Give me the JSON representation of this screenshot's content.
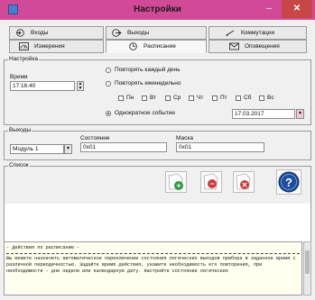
{
  "window": {
    "title": "Настройки",
    "min_symbol": "–",
    "close_symbol": "✕"
  },
  "tabs_row1": [
    {
      "label": "Входы"
    },
    {
      "label": "Выходы"
    },
    {
      "label": "Коммутации"
    }
  ],
  "tabs_row2": [
    {
      "label": "Измерения"
    },
    {
      "label": "Расписание"
    },
    {
      "label": "Оповещения"
    }
  ],
  "settings_group": {
    "label": "Настройка",
    "time_label": "Время",
    "time_value": "17:16:40",
    "repeat_daily": "Повторять каждый день",
    "repeat_weekly": "Повторять еженедельно",
    "days": [
      "Пн",
      "Вт",
      "Ср",
      "Чт",
      "Пт",
      "Сб",
      "Вс"
    ],
    "one_time": "Однократное событие",
    "date_value": "17.03.2017"
  },
  "outputs_group": {
    "label": "Выходы",
    "module_value": "Модуль 1",
    "state_label": "Состояние",
    "state_value": "0x01",
    "mask_label": "Маска",
    "mask_value": "0x01"
  },
  "list_group": {
    "label": "Список"
  },
  "toolbar": {
    "add_symbol": "+",
    "remove_symbol": "−",
    "delete_symbol": "✕",
    "help_symbol": "?"
  },
  "console": {
    "heading": "- Действия по расписанию -",
    "body": "Вы можете назначить автоматическое переключение состояния логических выходов прибора в заданное время с различной периодичностью. Задайте время действия, укажите необходимость его повторения, при необходимости - дни недели или календарную дату. Настройте состояние логических"
  },
  "colors": {
    "titlebar": "#d24a97",
    "close_button": "#c74646",
    "add": "#2e9a3e",
    "remove": "#d03a3a",
    "help": "#1f4e9c"
  }
}
